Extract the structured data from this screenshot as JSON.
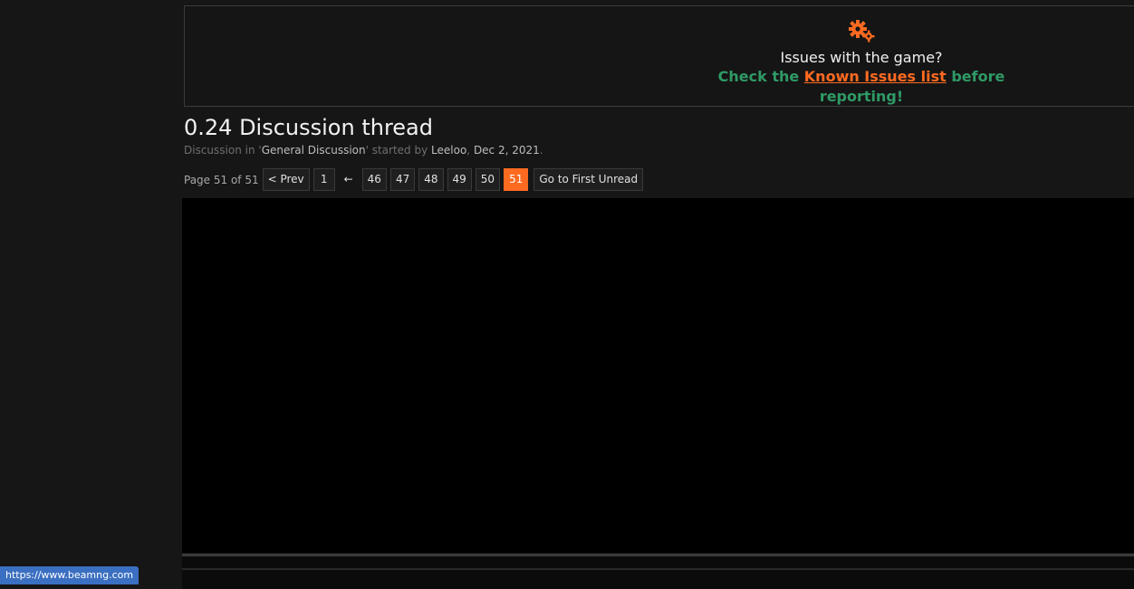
{
  "notice": {
    "icon": "gears-icon",
    "line1": "Issues with the game?",
    "line2_prefix": "Check the ",
    "line2_link": "Known Issues list",
    "line2_suffix": " before reporting!",
    "colors": {
      "accent": "#ff6a21",
      "green": "#2f9a66"
    }
  },
  "thread": {
    "title": "0.24 Discussion thread",
    "meta_prefix": "Discussion in '",
    "forum": "General Discussion",
    "meta_mid": "' started by ",
    "author": "Leeloo",
    "date_sep": ", ",
    "date": "Dec 2, 2021",
    "meta_end": "."
  },
  "pager": {
    "label": "Page 51 of 51",
    "prev": "< Prev",
    "first": "1",
    "skip": "←",
    "pages": [
      "46",
      "47",
      "48",
      "49",
      "50"
    ],
    "current": "51",
    "first_unread": "Go to First Unread"
  },
  "status_bar": {
    "url": "https://www.beamng.com"
  }
}
